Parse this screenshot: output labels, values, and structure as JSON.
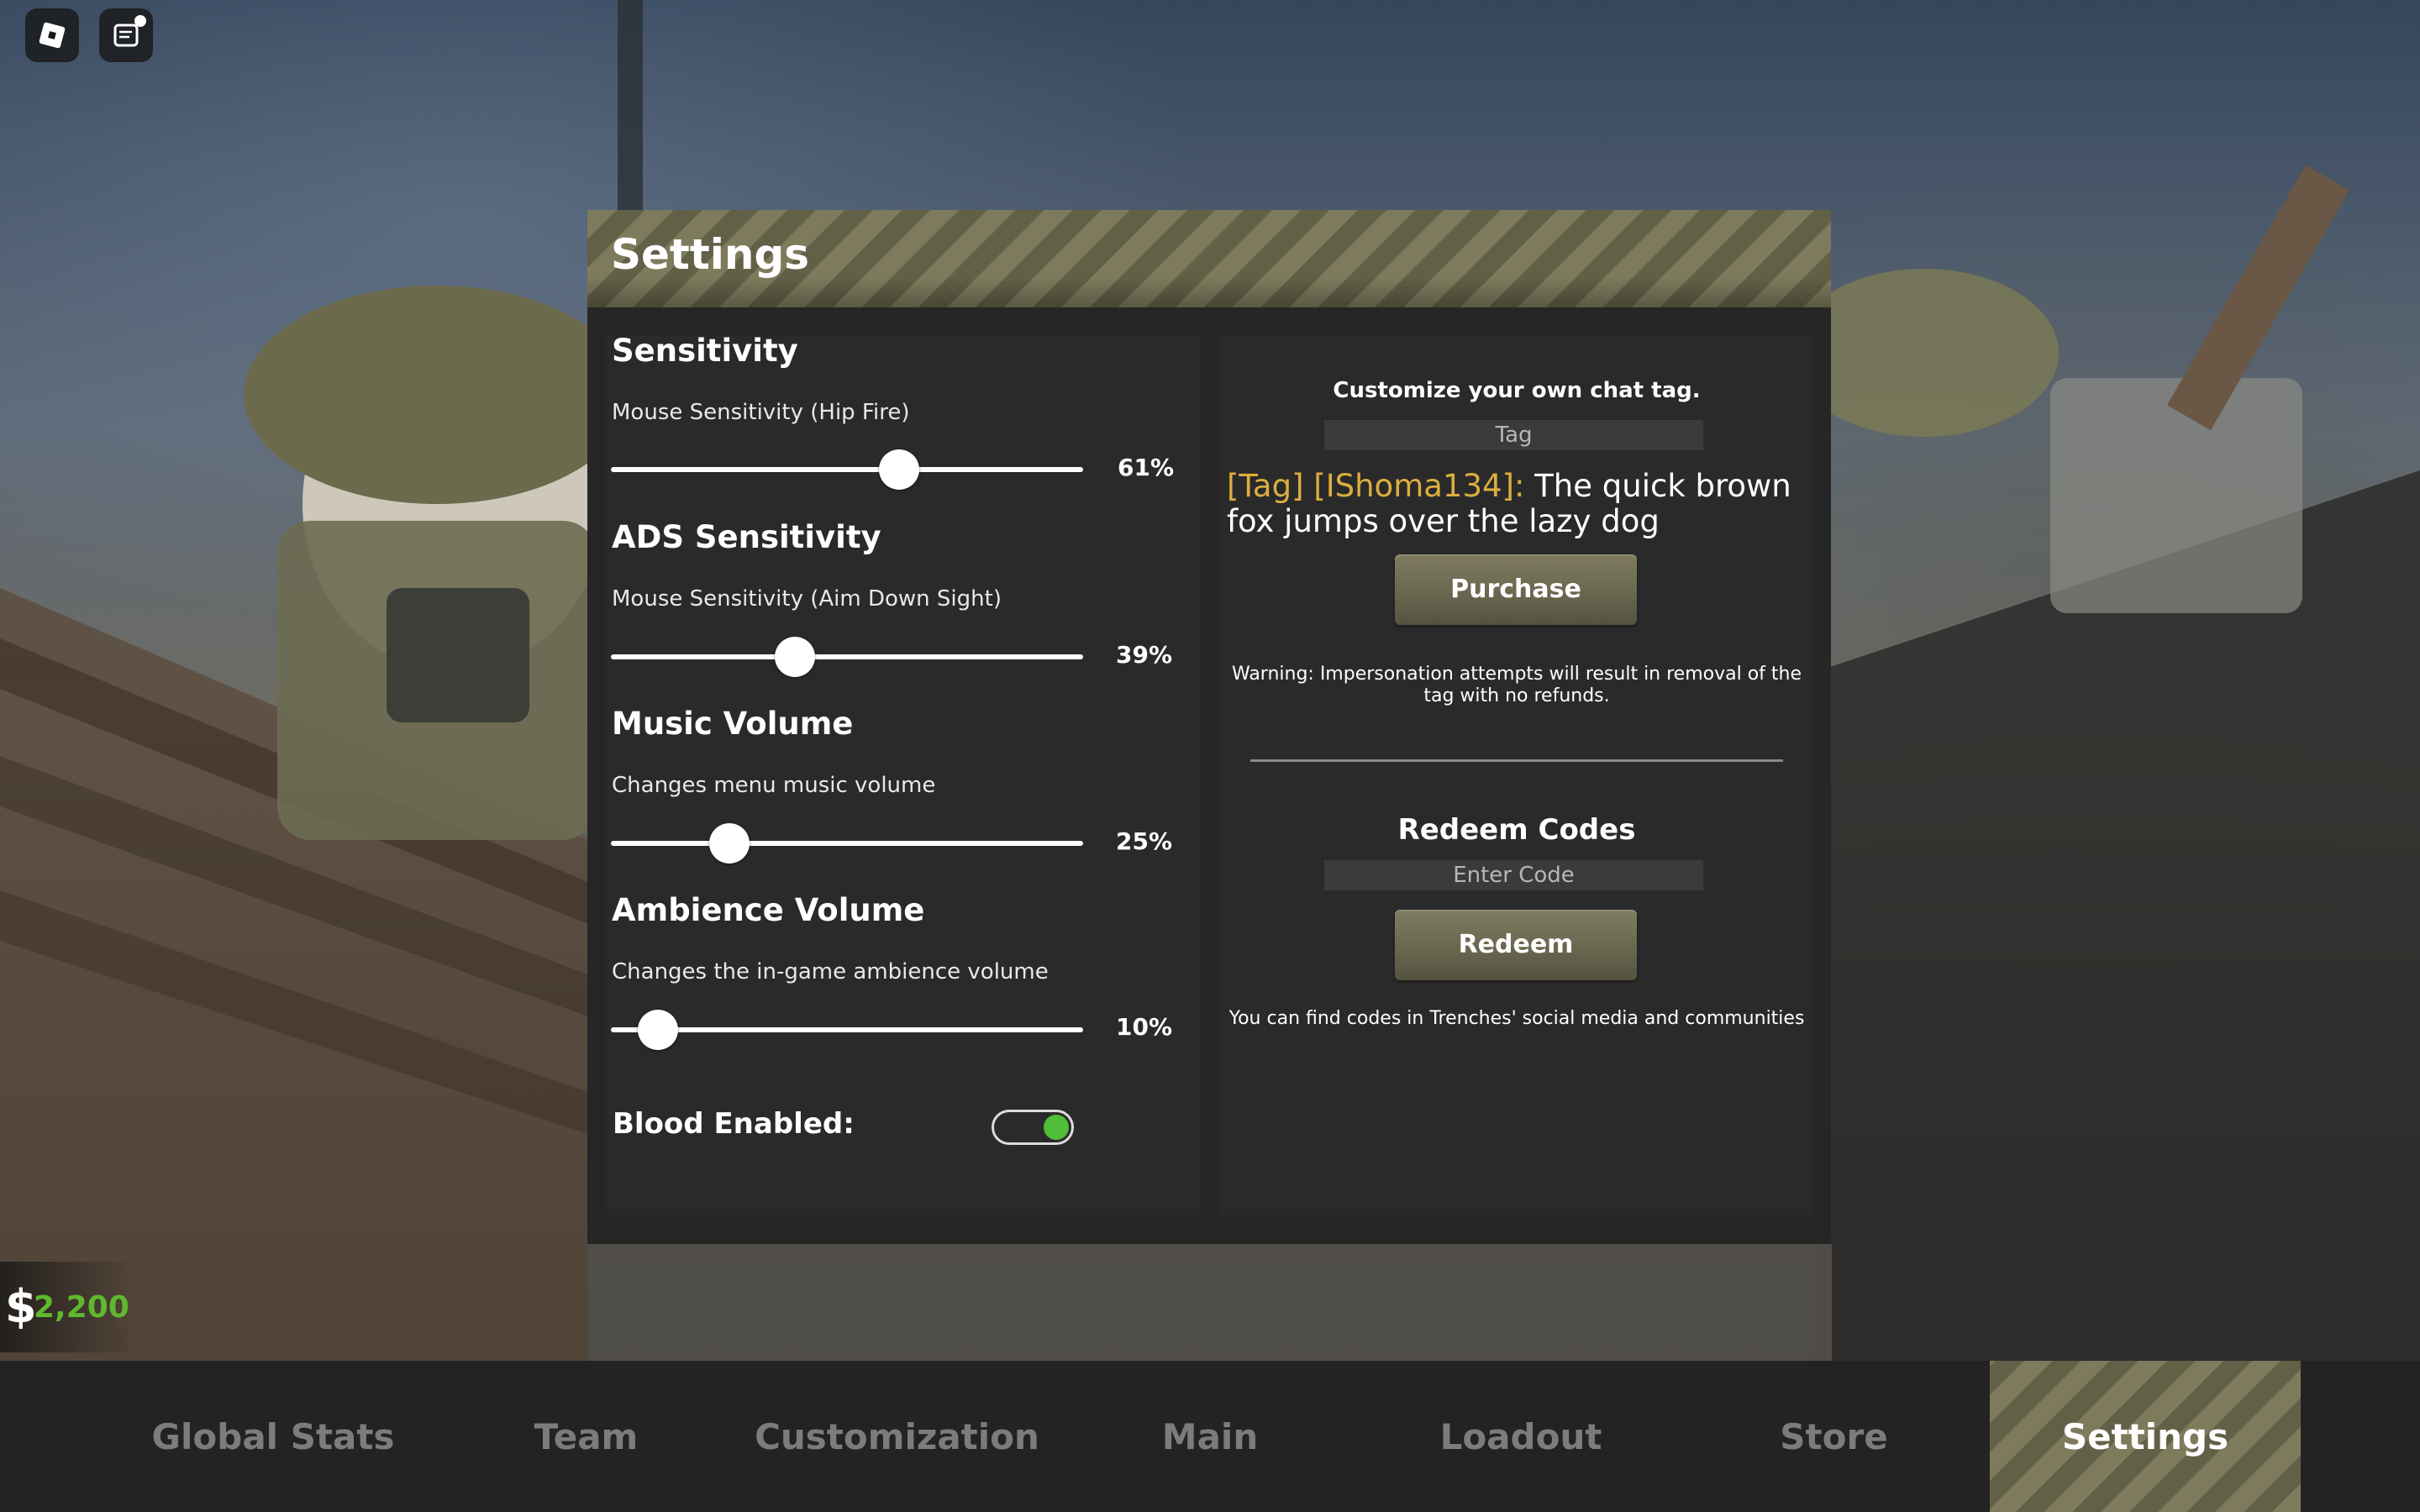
{
  "topbar": {
    "roblox_icon": "roblox-logo-icon",
    "chat_icon": "chat-icon"
  },
  "settings": {
    "title": "Settings",
    "sliders": [
      {
        "title": "Sensitivity",
        "subtitle": "Mouse Sensitivity (Hip Fire)",
        "value_label": "61%",
        "value": 0.61
      },
      {
        "title": "ADS Sensitivity",
        "subtitle": "Mouse Sensitivity (Aim Down Sight)",
        "value_label": "39%",
        "value": 0.39
      },
      {
        "title": "Music Volume",
        "subtitle": "Changes menu music volume",
        "value_label": "25%",
        "value": 0.25
      },
      {
        "title": "Ambience Volume",
        "subtitle": "Changes the in-game ambience volume",
        "value_label": "10%",
        "value": 0.1
      }
    ],
    "blood": {
      "label": "Blood Enabled:",
      "enabled": true
    }
  },
  "chat_tag": {
    "heading": "Customize your own chat tag.",
    "input_placeholder": "Tag",
    "preview_tag": "[Tag] [IShoma134]:",
    "preview_message": " The quick brown fox jumps over the lazy dog",
    "purchase_label": "Purchase",
    "warning": "Warning: Impersonation attempts will result in removal of the tag with no refunds."
  },
  "redeem": {
    "heading": "Redeem Codes",
    "input_placeholder": "Enter Code",
    "button_label": "Redeem",
    "note": "You can find codes in Trenches' social media and communities"
  },
  "currency": {
    "symbol": "$",
    "amount": "2,200"
  },
  "tabs": [
    {
      "label": "Global Stats",
      "active": false
    },
    {
      "label": "Team",
      "active": false
    },
    {
      "label": "Customization",
      "active": false
    },
    {
      "label": "Main",
      "active": false
    },
    {
      "label": "Loadout",
      "active": false
    },
    {
      "label": "Store",
      "active": false
    },
    {
      "label": "Settings",
      "active": true
    }
  ],
  "colors": {
    "accent_olive": "#7e7b5d",
    "panel_bg": "#262626",
    "tag_gold": "#dcae3f",
    "money_green": "#5fb82e",
    "toggle_green": "#4fbf3a"
  }
}
